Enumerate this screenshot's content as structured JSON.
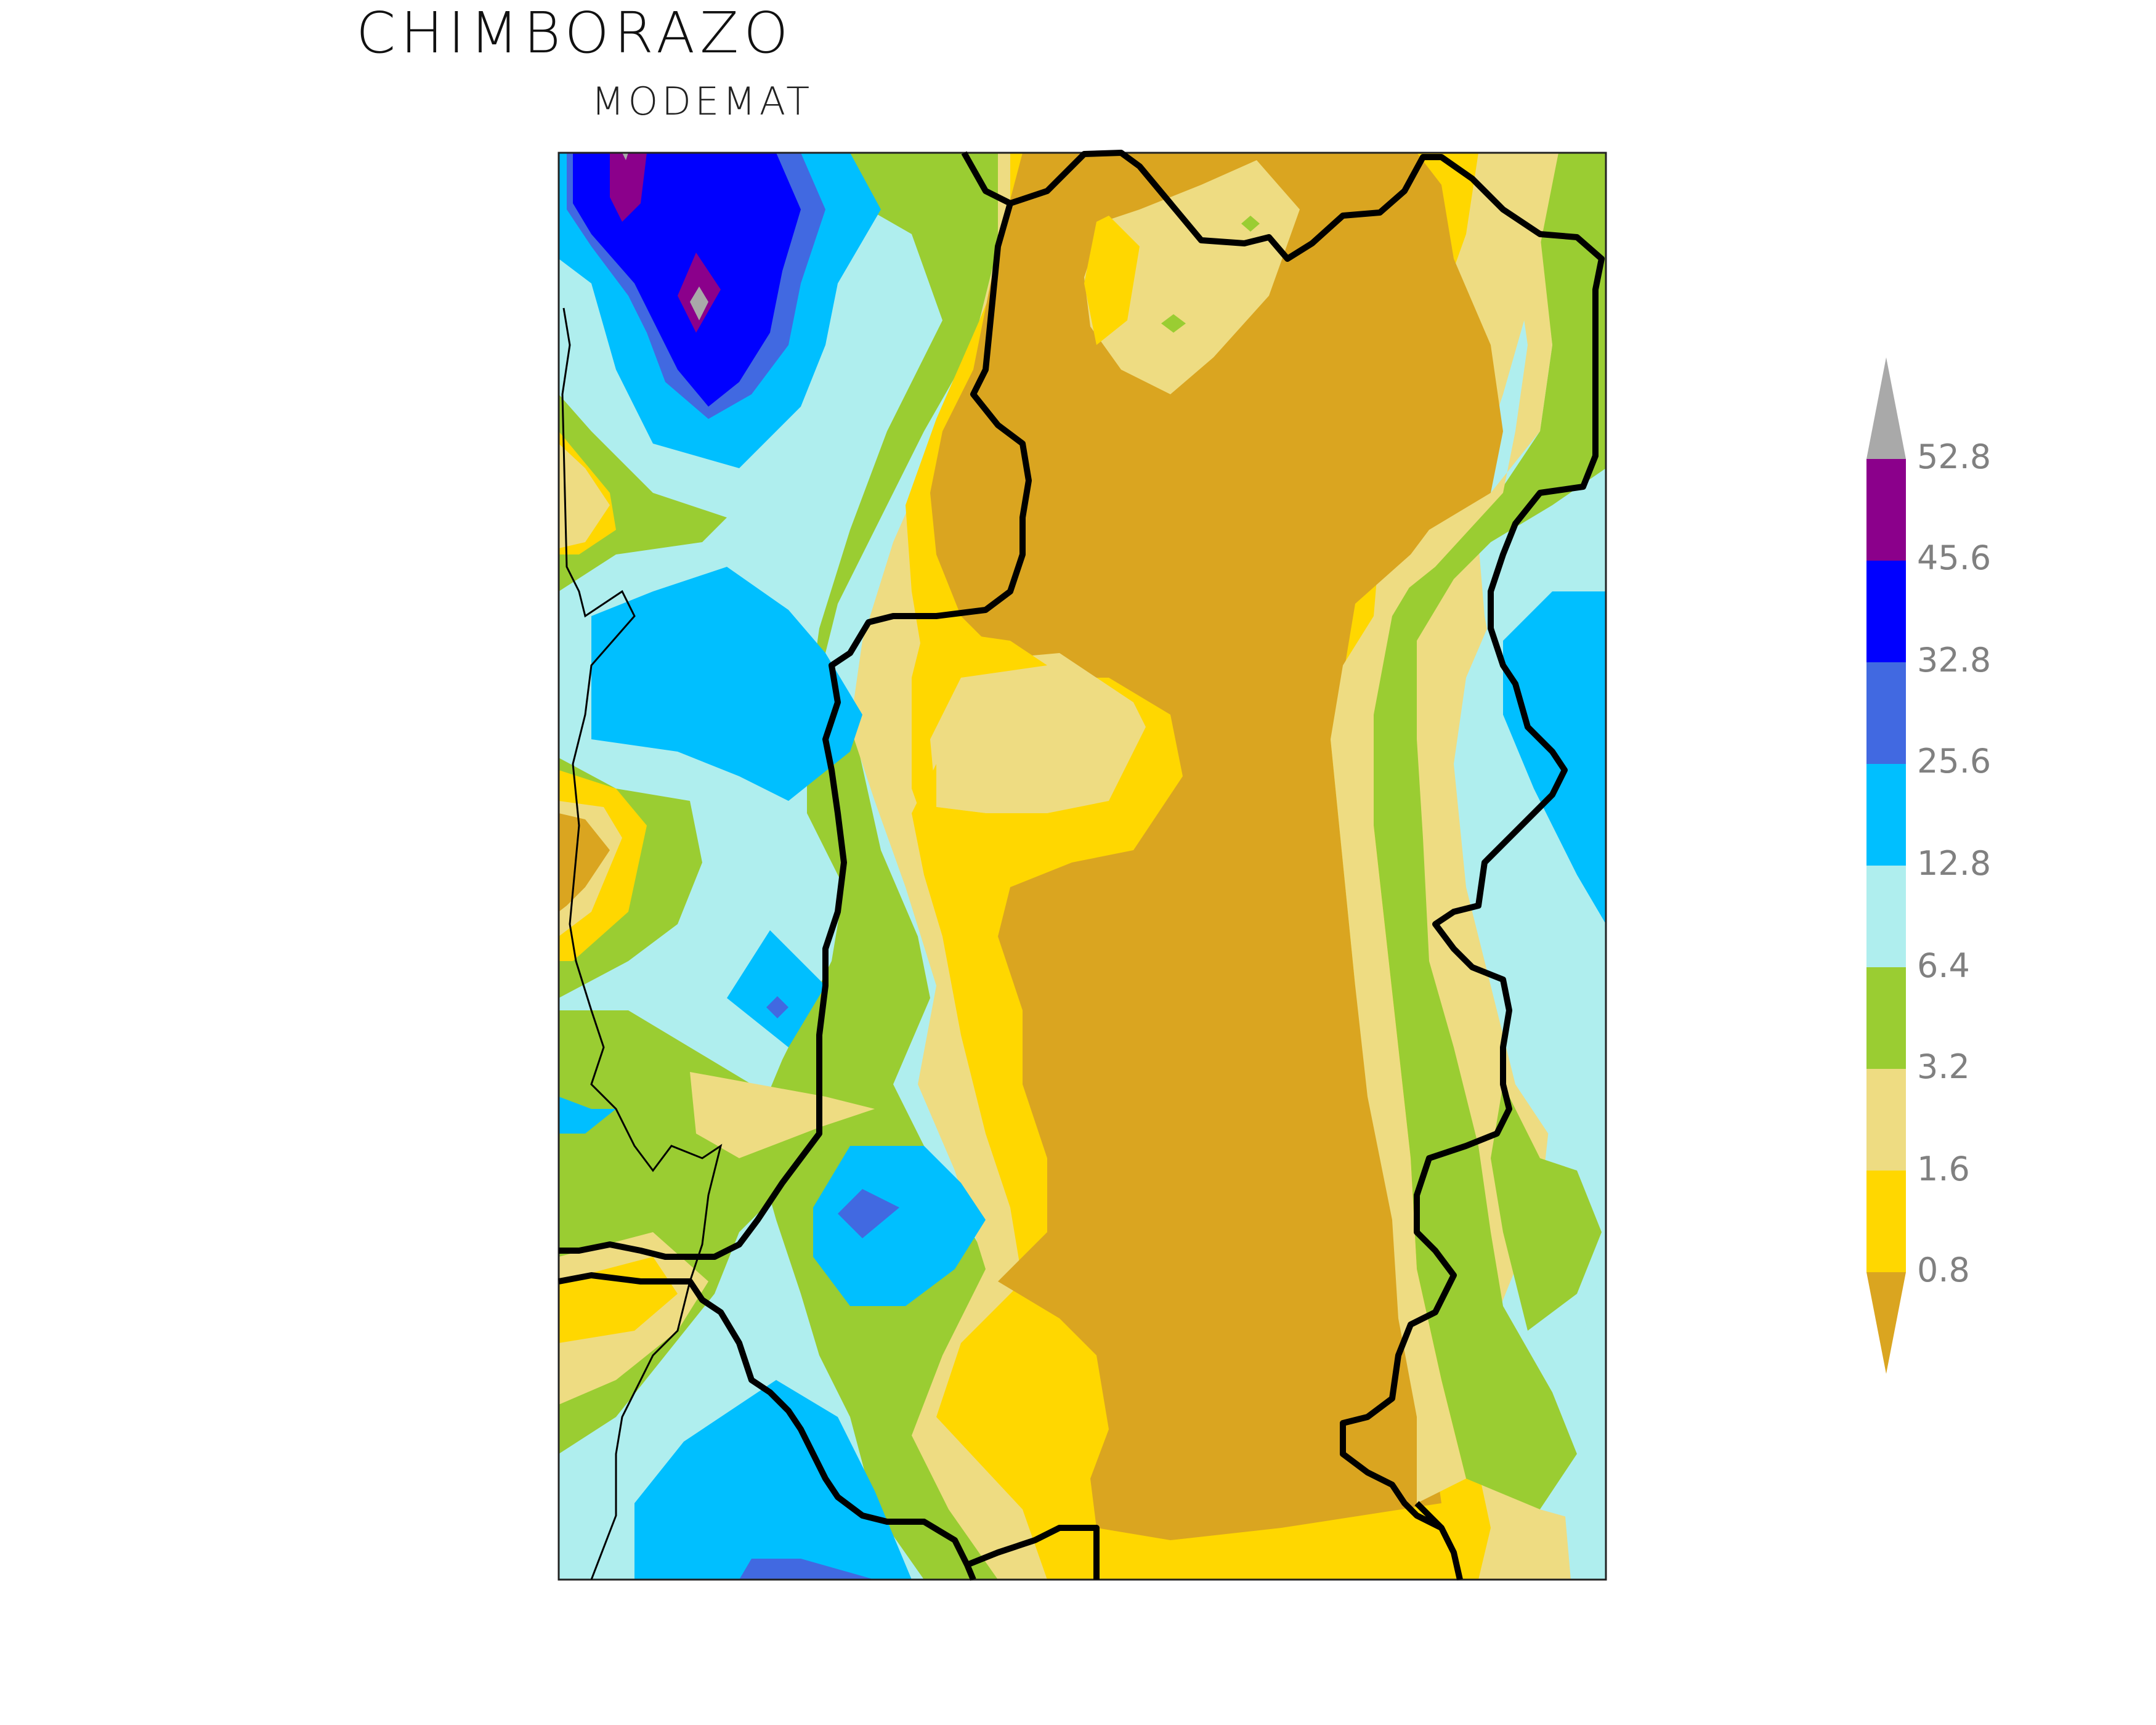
{
  "title": "CHIMBORAZO",
  "subtitle": "MODEMAT",
  "legend": {
    "labels": [
      "52.8",
      "45.6",
      "32.8",
      "25.6",
      "12.8",
      "6.4",
      "3.2",
      "1.6",
      "0.8"
    ],
    "colors": {
      "below_0_8": "#DAA520",
      "0_8_to_1_6": "#FFD700",
      "1_6_to_3_2": "#EEDC82",
      "3_2_to_6_4": "#9ACD32",
      "6_4_to_12_8": "#AFEEEE",
      "12_8_to_25_6": "#00BFFF",
      "25_6_to_32_8": "#4169E1",
      "32_8_to_45_6": "#0000FF",
      "45_6_to_52_8": "#8B008B",
      "above_52_8": "#A9A9A9"
    }
  }
}
